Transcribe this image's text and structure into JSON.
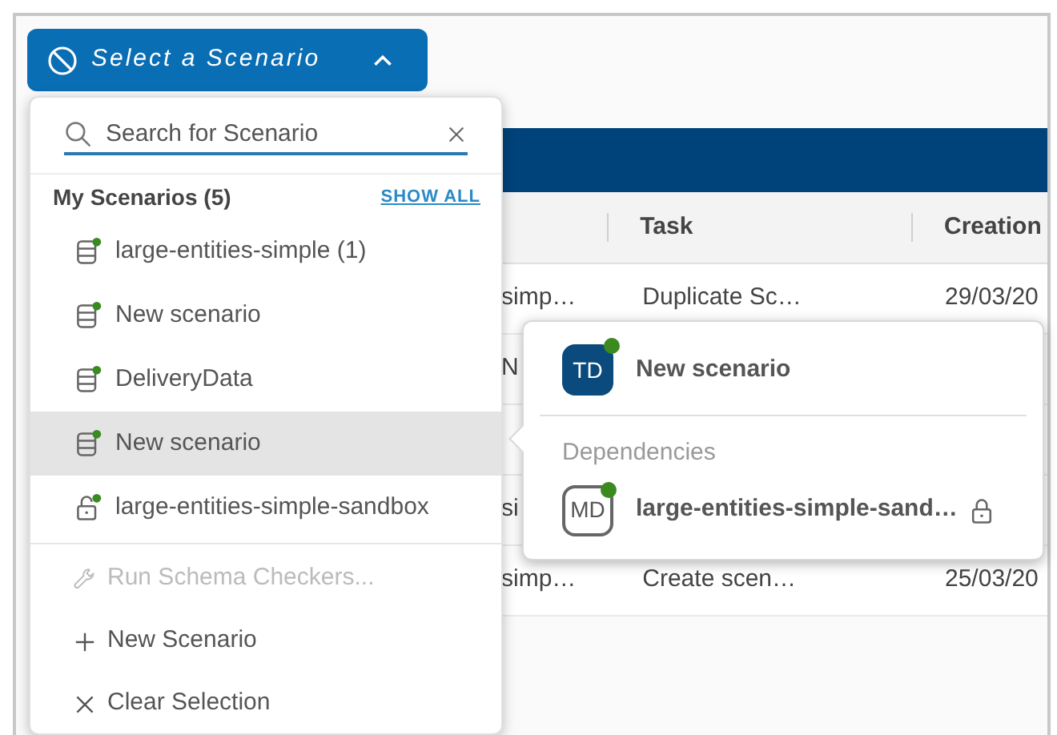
{
  "scenario_select": {
    "label": "Select a Scenario",
    "expanded": true
  },
  "table": {
    "columns": [
      "Task",
      "Creation"
    ],
    "rows": [
      {
        "column_1": "simp…",
        "task": "Duplicate Sc…",
        "creation": "29/03/20"
      },
      {
        "column_1": "N"
      },
      {},
      {
        "column_1": "si"
      },
      {
        "column_1": "simp…",
        "task": "Create scen…",
        "creation": "25/03/20"
      }
    ]
  },
  "dropdown": {
    "search": {
      "placeholder": "Search for Scenario"
    },
    "section_title": "My Scenarios (5)",
    "show_all": "SHOW ALL",
    "scenarios": [
      {
        "label": "large-entities-simple (1)",
        "kind": "database",
        "selected": false
      },
      {
        "label": "New scenario",
        "kind": "database",
        "selected": false
      },
      {
        "label": "DeliveryData",
        "kind": "database",
        "selected": false
      },
      {
        "label": "New scenario",
        "kind": "database",
        "selected": true
      },
      {
        "label": "large-entities-simple-sandbox",
        "kind": "locked",
        "selected": false
      }
    ],
    "actions": [
      {
        "label": "Run Schema Checkers...",
        "kind": "wrench",
        "disabled": true
      },
      {
        "label": "New Scenario",
        "kind": "plus",
        "disabled": false
      },
      {
        "label": "Clear Selection",
        "kind": "close",
        "disabled": false
      }
    ]
  },
  "popover": {
    "scenario": {
      "initials": "TD",
      "name": "New scenario",
      "kind": "filled"
    },
    "dependencies_title": "Dependencies",
    "dependencies": [
      {
        "initials": "MD",
        "name": "large-entities-simple-sand…",
        "kind": "outlined",
        "locked": true
      }
    ]
  }
}
